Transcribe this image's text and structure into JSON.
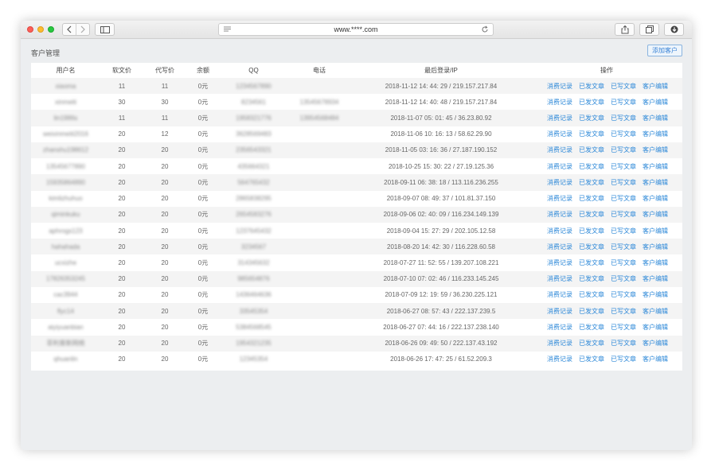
{
  "browser": {
    "url": "www.****.com"
  },
  "page": {
    "title": "客户管理",
    "add_button": "添加客户"
  },
  "table": {
    "headers": [
      "用户名",
      "软文价",
      "代写价",
      "余额",
      "QQ",
      "电话",
      "最后登录/IP",
      "操作"
    ],
    "actions": [
      "消费记录",
      "已发文章",
      "已写文章",
      "客户编辑"
    ],
    "rows": [
      {
        "user": "xiaoma",
        "soft": "11",
        "write": "11",
        "balance": "0元",
        "qq": "1234567890",
        "phone": "",
        "last": "2018-11-12 14: 44: 29 / 219.157.217.84"
      },
      {
        "user": "xinmeiti",
        "soft": "30",
        "write": "30",
        "balance": "0元",
        "qq": "8234561",
        "phone": "13545678934",
        "last": "2018-11-12 14: 40: 48 / 219.157.217.84"
      },
      {
        "user": "lin1986s",
        "soft": "11",
        "write": "11",
        "balance": "0元",
        "qq": "1958321776",
        "phone": "13954568484",
        "last": "2018-11-07 05: 01: 45 / 36.23.80.92"
      },
      {
        "user": "weixinmeiti2016",
        "soft": "20",
        "write": "12",
        "balance": "0元",
        "qq": "3628569483",
        "phone": "",
        "last": "2018-11-06 10: 16: 13 / 58.62.29.90"
      },
      {
        "user": "zhanshu198612",
        "soft": "20",
        "write": "20",
        "balance": "0元",
        "qq": "2356543321",
        "phone": "",
        "last": "2018-11-05 03: 16: 36 / 27.187.190.152"
      },
      {
        "user": "13545677890",
        "soft": "20",
        "write": "20",
        "balance": "0元",
        "qq": "435664321",
        "phone": "",
        "last": "2018-10-25 15: 30: 22 / 27.19.125.36"
      },
      {
        "user": "15935864890",
        "soft": "20",
        "write": "20",
        "balance": "0元",
        "qq": "564765432",
        "phone": "",
        "last": "2018-09-11 06: 38: 18 / 113.116.236.255"
      },
      {
        "user": "kimlizhuhuo",
        "soft": "20",
        "write": "20",
        "balance": "0元",
        "qq": "2865838295",
        "phone": "",
        "last": "2018-09-07 08: 49: 37 / 101.81.37.150"
      },
      {
        "user": "qiminkuku",
        "soft": "20",
        "write": "20",
        "balance": "0元",
        "qq": "2654583276",
        "phone": "",
        "last": "2018-09-06 02: 40: 09 / 116.234.149.139"
      },
      {
        "user": "aphrogs123",
        "soft": "20",
        "write": "20",
        "balance": "0元",
        "qq": "1237645432",
        "phone": "",
        "last": "2018-09-04 15: 27: 29 / 202.105.12.58"
      },
      {
        "user": "hahahada",
        "soft": "20",
        "write": "20",
        "balance": "0元",
        "qq": "3234567",
        "phone": "",
        "last": "2018-08-20 14: 42: 30 / 116.228.60.58"
      },
      {
        "user": "ucxizhe",
        "soft": "20",
        "write": "20",
        "balance": "0元",
        "qq": "314345632",
        "phone": "",
        "last": "2018-07-27 11: 52: 55 / 139.207.108.221"
      },
      {
        "user": "17826353245",
        "soft": "20",
        "write": "20",
        "balance": "0元",
        "qq": "985654876",
        "phone": "",
        "last": "2018-07-10 07: 02: 46 / 116.233.145.245"
      },
      {
        "user": "cac3944",
        "soft": "20",
        "write": "20",
        "balance": "0元",
        "qq": "1436464636",
        "phone": "",
        "last": "2018-07-09 12: 19: 59 / 36.230.225.121"
      },
      {
        "user": "flyc14",
        "soft": "20",
        "write": "20",
        "balance": "0元",
        "qq": "33545354",
        "phone": "",
        "last": "2018-06-27 08: 57: 43 / 222.137.239.5"
      },
      {
        "user": "aiyiyuanbian",
        "soft": "20",
        "write": "20",
        "balance": "0元",
        "qq": "5384568545",
        "phone": "",
        "last": "2018-06-27 07: 44: 16 / 222.137.238.140"
      },
      {
        "user": "菲利普斯网络",
        "soft": "20",
        "write": "20",
        "balance": "0元",
        "qq": "1954321235",
        "phone": "",
        "last": "2018-06-26 09: 49: 50 / 222.137.43.192"
      },
      {
        "user": "qhuanlin",
        "soft": "20",
        "write": "20",
        "balance": "0元",
        "qq": "12345354",
        "phone": "",
        "last": "2018-06-26 17: 47: 25 / 61.52.209.3"
      }
    ]
  },
  "icons": {
    "back": "chevron-left-icon",
    "forward": "chevron-right-icon",
    "sidebar": "sidebar-icon",
    "reader": "reader-icon",
    "reload": "reload-icon",
    "share": "share-icon",
    "tabs": "tabs-icon",
    "downloads": "download-icon"
  },
  "colors": {
    "link": "#2e89d8",
    "stripe": "#f4f4f4",
    "page_bg": "#eceef0"
  }
}
